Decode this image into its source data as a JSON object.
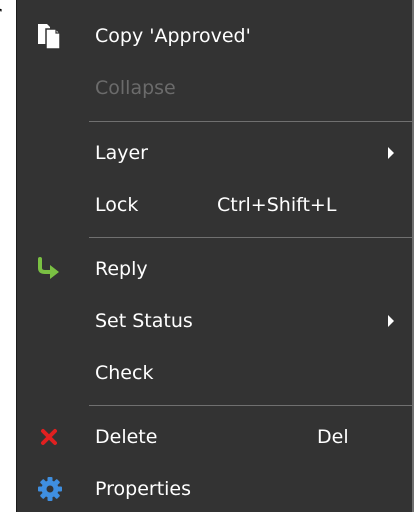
{
  "background_text": "r",
  "context_menu": {
    "items": {
      "copy": {
        "label": "Copy 'Approved'",
        "icon": "copy-icon"
      },
      "collapse": {
        "label": "Collapse"
      },
      "layer": {
        "label": "Layer"
      },
      "lock": {
        "label": "Lock",
        "shortcut": "Ctrl+Shift+L"
      },
      "reply": {
        "label": "Reply",
        "icon": "reply-arrow-icon"
      },
      "set_status": {
        "label": "Set Status"
      },
      "check": {
        "label": "Check"
      },
      "delete": {
        "label": "Delete",
        "shortcut": "Del",
        "icon": "delete-x-icon"
      },
      "properties": {
        "label": "Properties",
        "icon": "gear-icon"
      }
    }
  },
  "colors": {
    "menu_background": "#333333",
    "text": "#ffffff",
    "disabled_text": "#6b6b6b",
    "separator": "#707070",
    "reply_icon": "#7ac043",
    "delete_icon": "#e02020",
    "gear_icon": "#3f8fe0"
  }
}
